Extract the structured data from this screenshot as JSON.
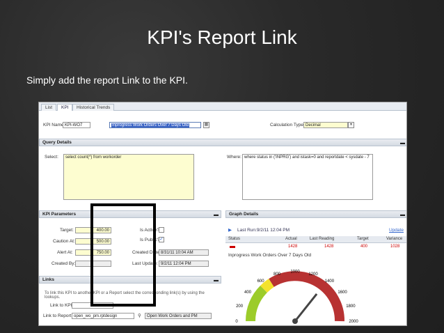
{
  "slide": {
    "title": "KPI's Report Link",
    "subtitle": "Simply add the report Link to the KPI."
  },
  "tabs": [
    {
      "label": "List"
    },
    {
      "label": "KPI"
    },
    {
      "label": "Historical Trends"
    }
  ],
  "kpi": {
    "name_label": "KPI Name:",
    "name_value": "KPI-WO7",
    "description": "Inprogress Work Orders Over 7 Days Old",
    "calc_label": "Calculation Type:",
    "calc_value": "Decimal"
  },
  "query": {
    "section": "Query Details",
    "select_label": "Select:",
    "select_value": "select count(*) from workorder",
    "where_label": "Where:",
    "where_value": "where status in ('INPRG') and istask=0 and reportdate < sysdate - 7"
  },
  "params": {
    "section": "KPI Parameters",
    "target_label": "Target:",
    "target_value": "400.00",
    "caution_label": "Caution At:",
    "caution_value": "500.00",
    "alert_label": "Alert At:",
    "alert_value": "750.00",
    "created_by_label": "Created By:",
    "created_by_value": "",
    "is_active_label": "Is Active?",
    "is_public_label": "Is Public?",
    "created_date_label": "Created Date:",
    "created_date_value": "8/31/11 10:04 AM",
    "last_update_label": "Last Update:",
    "last_update_value": "9/2/11 12:04 PM"
  },
  "links": {
    "section": "Links",
    "help": "To link this KPI to another KPI or a Report select the corresponding link(s) by using the lookups.",
    "link_kpi_label": "Link to KPI:",
    "link_kpi_value": "",
    "link_report_label": "Link to Report:",
    "link_report_value": "open_wo_pm.rptdesign",
    "open_label": "Open Work Orders and PM"
  },
  "graph": {
    "section": "Graph Details",
    "last_run": "Last Run:9/2/11 12:04 PM",
    "update_label": "Update",
    "headers": [
      "Status",
      "Actual",
      "Last Reading",
      "Target",
      "Variance"
    ],
    "row": {
      "actual": "1428",
      "last": "1428",
      "target": "400",
      "variance": "1028"
    },
    "caption": "Inprogress Work Orders Over 7 Days Old",
    "gauge_labels": [
      "0",
      "200",
      "400",
      "600",
      "800",
      "1000",
      "1200",
      "1400",
      "1600",
      "1800",
      "2000"
    ],
    "gauge_value": 1428,
    "gauge_max": 2000
  }
}
